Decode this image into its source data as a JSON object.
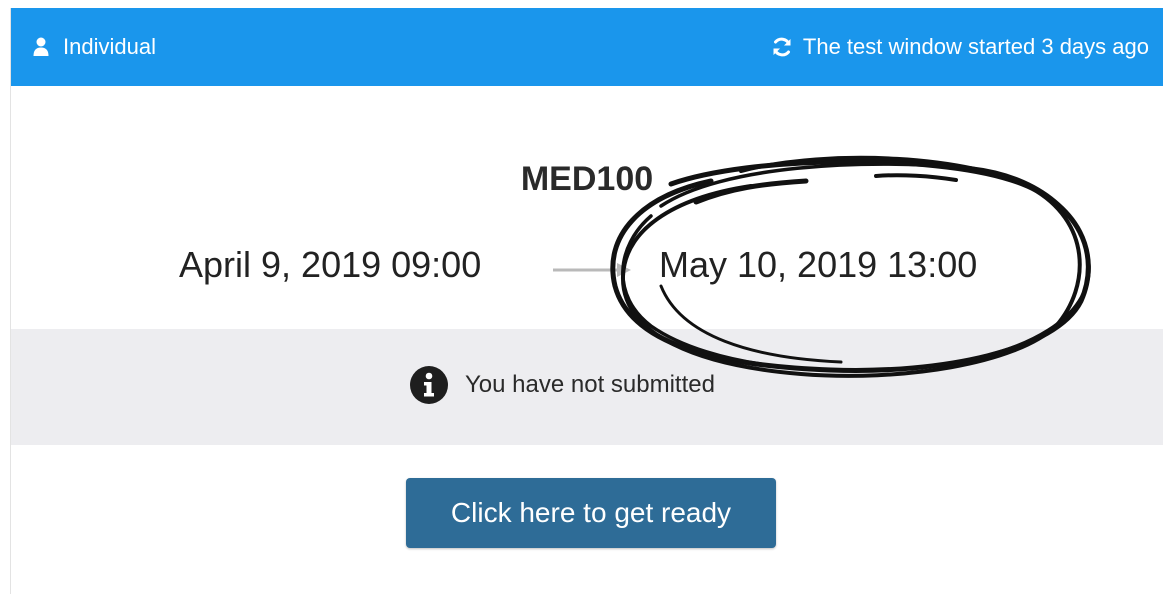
{
  "header": {
    "mode_label": "Individual",
    "mode_icon": "user-icon",
    "window_status": "The test window started 3 days ago",
    "window_icon": "refresh-icon",
    "bar_color": "#1a96ec"
  },
  "test": {
    "code": "MED100",
    "start": "April 9, 2019  09:00",
    "end": "May 10, 2019  13:00",
    "arrow_icon": "arrow-right-icon"
  },
  "submission": {
    "status_text": "You have not submitted",
    "status_icon": "info-icon",
    "band_color": "#ededf0"
  },
  "actions": {
    "ready_label": "Click here to get ready",
    "button_color": "#2e6c97"
  },
  "annotation": {
    "mark": "hand-drawn-circle"
  }
}
